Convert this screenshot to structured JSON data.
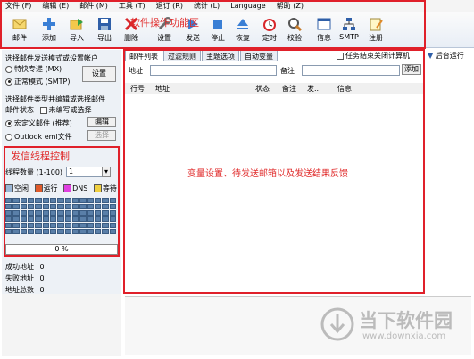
{
  "menu": [
    "文件 (F)",
    "编辑 (E)",
    "邮件 (M)",
    "工具 (T)",
    "退订 (R)",
    "统计 (L)",
    "Language",
    "帮助 (Z)"
  ],
  "toolbar": {
    "buttons": [
      "邮件",
      "添加",
      "导入",
      "导出",
      "删除",
      "设置",
      "发送",
      "停止",
      "恢复",
      "定时",
      "校验",
      "信息",
      "SMTP",
      "注册"
    ],
    "annotation": "软件操作功能区"
  },
  "left": {
    "send_mode_header": "选择邮件发送模式或设置帐户",
    "radio_special": "特快专递 (MX)",
    "radio_normal": "正常模式 (SMTP)",
    "settings_button": "设置",
    "mail_type_header": "选择邮件类型并编辑或选择邮件",
    "mail_status_label": "邮件状态",
    "mail_status_check": "未编写或选择",
    "radio_macro": "宏定义邮件 (推荐)",
    "edit_button": "编辑",
    "radio_outlook": "Outlook eml文件",
    "select_button": "选择",
    "thread_annotation": "发信线程控制",
    "thread_count_label": "线程数量 (1-100)",
    "thread_count_value": "1",
    "legend": [
      "空闲",
      "运行",
      "DNS",
      "等待"
    ],
    "progress": "0 %",
    "success_label": "成功地址",
    "success_value": "0",
    "fail_label": "失败地址",
    "fail_value": "0",
    "total_label": "地址总数",
    "total_value": "0"
  },
  "tabs": [
    "邮件列表",
    "过滤规则",
    "主题选项",
    "自动变量"
  ],
  "options": {
    "shutdown_check": "任务结束关闭计算机",
    "background": "后台运行"
  },
  "addr": {
    "address_label": "地址",
    "remark_label": "备注",
    "add_button": "添加"
  },
  "columns": [
    "行号",
    "地址",
    "状态",
    "备注",
    "发...",
    "信息"
  ],
  "main_annotation": "变量设置、待发送邮箱以及发送结果反馈",
  "watermark": {
    "title": "当下软件园",
    "url": "www.downxia.com"
  },
  "colors": {
    "annotation_red": "#e0202a",
    "legend_idle": "#9ab6d6",
    "legend_run": "#e05a2a",
    "legend_dns": "#e040e0",
    "legend_wait": "#f0d040"
  }
}
